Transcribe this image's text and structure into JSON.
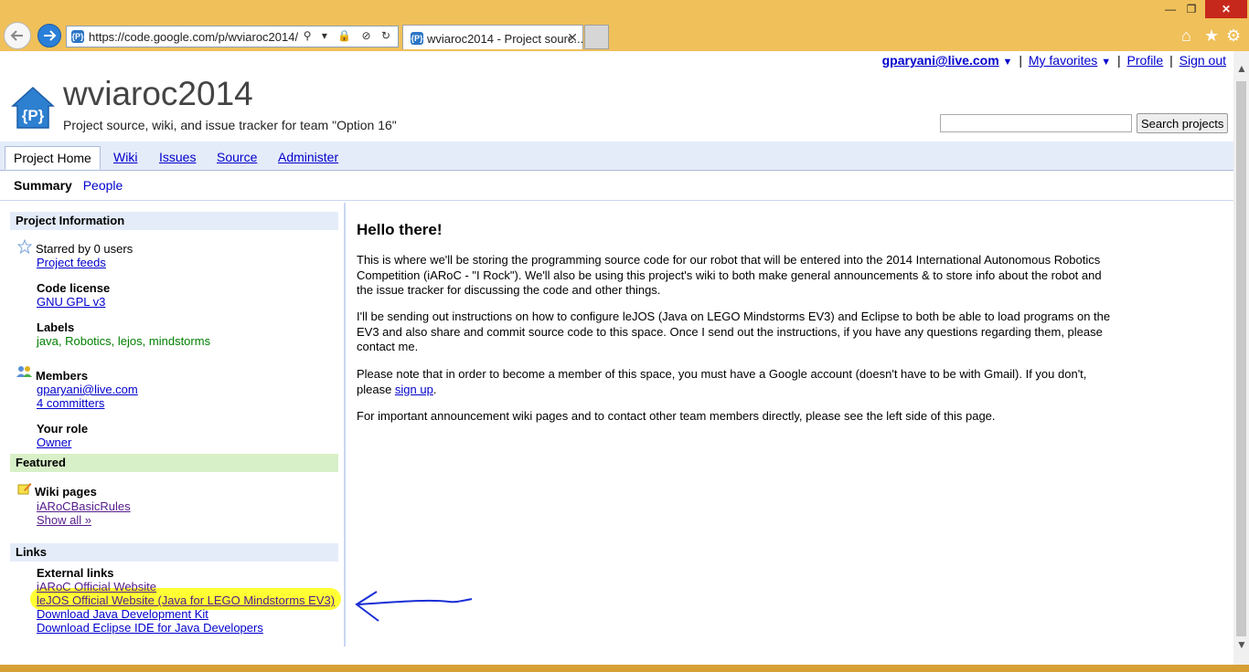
{
  "browser": {
    "url": "https://code.google.com/p/wviaroc2014/",
    "tab_title": "wviaroc2014 - Project sourc...",
    "tab_close": "✕",
    "favicon_text": "{P}",
    "address_tools": "⚲ ▾ 🔒 ⊘ ↻",
    "window": {
      "minimize": "—",
      "restore": "❐",
      "close": "✕"
    },
    "toolbar_icons": [
      "home-icon",
      "star-icon",
      "gear-icon"
    ]
  },
  "userbar": {
    "email": "gparyani@live.com",
    "email_caret": "▼",
    "favorites": "My favorites",
    "favorites_caret": "▼",
    "profile": "Profile",
    "signout": "Sign out",
    "separator": "|"
  },
  "project": {
    "logo_text": "{P}",
    "name": "wviaroc2014",
    "summary": "Project source, wiki, and issue tracker for team \"Option 16\""
  },
  "search": {
    "value": "",
    "button": "Search projects"
  },
  "tabs": {
    "home": "Project Home",
    "wiki": "Wiki",
    "issues": "Issues",
    "source": "Source",
    "administer": "Administer"
  },
  "subnav": {
    "summary": "Summary",
    "people": "People"
  },
  "sidebar": {
    "info_header": "Project Information",
    "starred": "Starred by 0 users",
    "feeds": "Project feeds",
    "license_title": "Code license",
    "license": "GNU GPL v3",
    "labels_title": "Labels",
    "labels": [
      "java",
      "Robotics",
      "lejos",
      "mindstorms"
    ],
    "label_sep": ", ",
    "members_title": "Members",
    "member_email": "gparyani@live.com",
    "committers": "4 committers",
    "role_title": "Your role",
    "role": "Owner",
    "featured_header": "Featured",
    "wiki_title": "Wiki pages",
    "wiki_page": "iARoCBasicRules",
    "show_all": "Show all »",
    "links_header": "Links",
    "external_title": "External links",
    "external": [
      "iARoC Official Website",
      "leJOS Official Website (Java for LEGO Mindstorms EV3)",
      "Download Java Development Kit",
      "Download Eclipse IDE for Java Developers"
    ]
  },
  "content": {
    "heading": "Hello there!",
    "p1": "This is where we'll be storing the programming source code for our robot that will be entered into the 2014 International Autonomous Robotics Competition (iARoC - \"I Rock\"). We'll also be using this project's wiki to both make general announcements & to store info about the robot and the issue tracker for discussing the code and other things.",
    "p2": "I'll be sending out instructions on how to configure leJOS (Java on LEGO Mindstorms EV3) and Eclipse to both be able to load programs on the EV3 and also share and commit source code to this space. Once I send out the instructions, if you have any questions regarding them, please contact me.",
    "p3_before": "Please note that in order to become a member of this space, you must have a Google account (doesn't have to be with Gmail). If you don't, please ",
    "p3_link": "sign up",
    "p3_after": ".",
    "p4": "For important announcement wiki pages and to contact other team members directly, please see the left side of this page."
  },
  "colors": {
    "chrome": "#f0c05a",
    "link": "#0000cc",
    "visited": "#551a8b",
    "label_green": "#008000",
    "highlight": "#ffff33",
    "annotation_arrow": "#1a2fd6",
    "tab_bar": "#e5ecf9"
  }
}
